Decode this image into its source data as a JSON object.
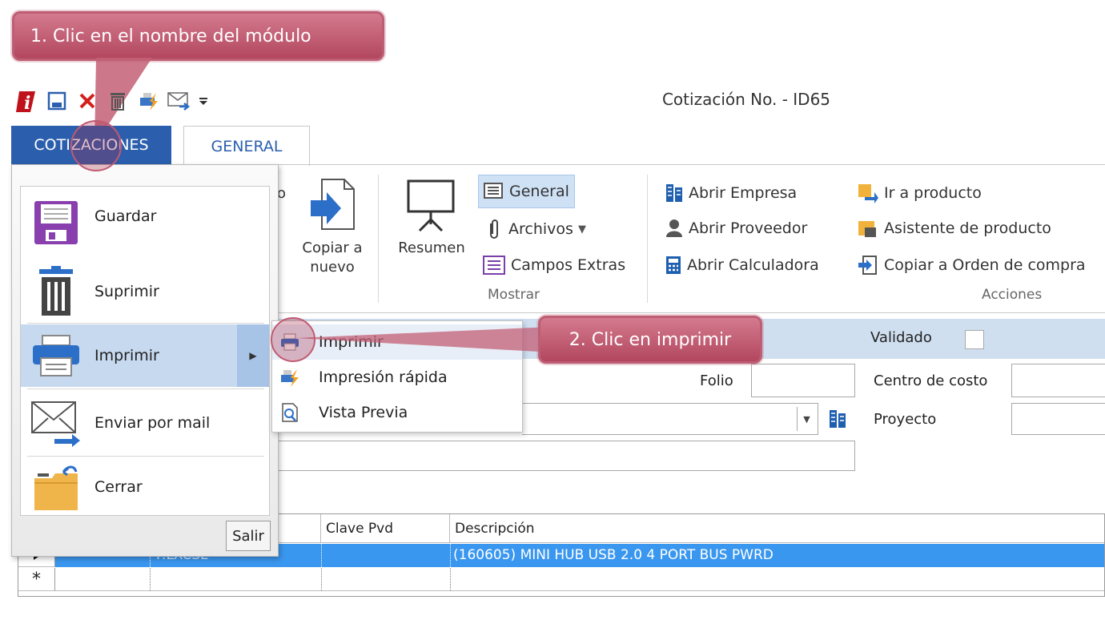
{
  "callouts": {
    "step1": "1. Clic en el nombre del módulo",
    "step2": "2. Clic en imprimir"
  },
  "titlebar": {
    "title": "Cotización No. - ID65",
    "qat_icons": [
      "app-logo-icon",
      "save-icon",
      "delete-x-icon",
      "trash-icon",
      "quick-print-icon",
      "mail-icon",
      "dropdown-arrow-icon"
    ]
  },
  "tabs": {
    "module": "COTIZACIONES",
    "general": "GENERAL"
  },
  "ribbon": {
    "partial_label": "o",
    "copiar_line1": "Copiar a",
    "copiar_line2": "nuevo",
    "resumen": "Resumen",
    "general": "General",
    "archivos": "Archivos",
    "campos_extras": "Campos Extras",
    "mostrar_group": "Mostrar",
    "abrir_empresa": "Abrir Empresa",
    "abrir_proveedor": "Abrir Proveedor",
    "abrir_calculadora": "Abrir Calculadora",
    "ir_producto": "Ir a producto",
    "asistente_producto": "Asistente de producto",
    "copiar_orden": "Copiar a Orden de compra",
    "acciones_group": "Acciones"
  },
  "form": {
    "validado": "Validado",
    "folio": "Folio",
    "centro_costo": "Centro de costo",
    "proyecto": "Proyecto"
  },
  "grid": {
    "headers": [
      "Clave Pvd",
      "Descripción"
    ],
    "row1": {
      "partial": "F.LXCSL",
      "description": "(160605) MINI HUB USB 2.0 4 PORT BUS PWRD"
    },
    "new_row_marker": "*"
  },
  "menu": {
    "items": [
      {
        "label": "Guardar",
        "icon": "save-floppy-icon"
      },
      {
        "label": "Suprimir",
        "icon": "trash-bin-icon"
      },
      {
        "label": "Imprimir",
        "icon": "printer-icon"
      },
      {
        "label": "Enviar por mail",
        "icon": "envelope-send-icon"
      },
      {
        "label": "Cerrar",
        "icon": "close-folder-icon"
      }
    ],
    "salir": "Salir"
  },
  "submenu": {
    "items": [
      {
        "label": "Imprimir",
        "icon": "printer-small-icon"
      },
      {
        "label": "Impresión rápida",
        "icon": "quick-print-small-icon"
      },
      {
        "label": "Vista Previa",
        "icon": "print-preview-icon"
      }
    ]
  },
  "colors": {
    "module_tab": "#2b5fad",
    "selected_row": "#3a97ef",
    "callout": "#b2475f",
    "form_bar": "#cfdff0"
  }
}
